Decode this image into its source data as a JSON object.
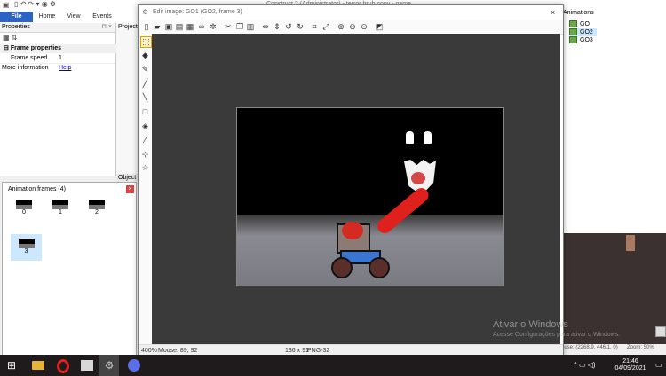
{
  "window": {
    "title": "Construct 2 (Administrator) - terror bruh copy - game"
  },
  "ribbon": {
    "tabs": [
      "File",
      "Home",
      "View",
      "Events"
    ]
  },
  "properties": {
    "header": "Properties",
    "section": "Frame properties",
    "rows": [
      {
        "label": "Frame speed",
        "value": "1"
      },
      {
        "label": "More information",
        "value": "Help"
      }
    ]
  },
  "side_tabs": {
    "projects": "Projects",
    "objects": "Object"
  },
  "animations": {
    "header": "Animations",
    "items": [
      "GO",
      "GO2",
      "GO3"
    ]
  },
  "frames_panel": {
    "title": "Animation frames (4)",
    "frames": [
      "0",
      "1",
      "2",
      "3"
    ]
  },
  "editor": {
    "title": "Edit image: GO1 (GO2, frame 3)",
    "status": {
      "zoom": "400%",
      "mouse": "Mouse: 89, 92",
      "size": "136 x 91",
      "format": "PNG-32"
    }
  },
  "layout_status": {
    "mouse": "ouse: (2268.9, 446.1, 0)",
    "zoom": "Zoom: 50%"
  },
  "watermark": {
    "line1": "Ativar o Windows",
    "line2": "Acesse Configurações para ativar o Windows."
  },
  "clock": {
    "time": "21:46",
    "date": "04/09/2021"
  },
  "colors": {
    "accent": "#2b63c7",
    "selection": "#cce8ff",
    "blood": "#e0201c"
  },
  "icons": {
    "toolbar": [
      "new-icon",
      "open-icon",
      "save-icon",
      "save-as-icon",
      "export-icon",
      "link-icon",
      "settings-icon",
      "cut-icon",
      "copy-icon",
      "paste-icon",
      "mirror-icon",
      "flip-icon",
      "rotate-ccw-icon",
      "rotate-cw-icon",
      "crop-icon",
      "resize-icon",
      "zoom-in-icon",
      "zoom-out-icon",
      "zoom-fit-icon",
      "edit-icon"
    ],
    "tools": [
      "select-icon",
      "eraser-icon",
      "pencil-icon",
      "brush-icon",
      "line-icon",
      "rectangle-icon",
      "fill-icon",
      "eyedropper-icon",
      "origin-icon",
      "polygon-icon"
    ]
  }
}
